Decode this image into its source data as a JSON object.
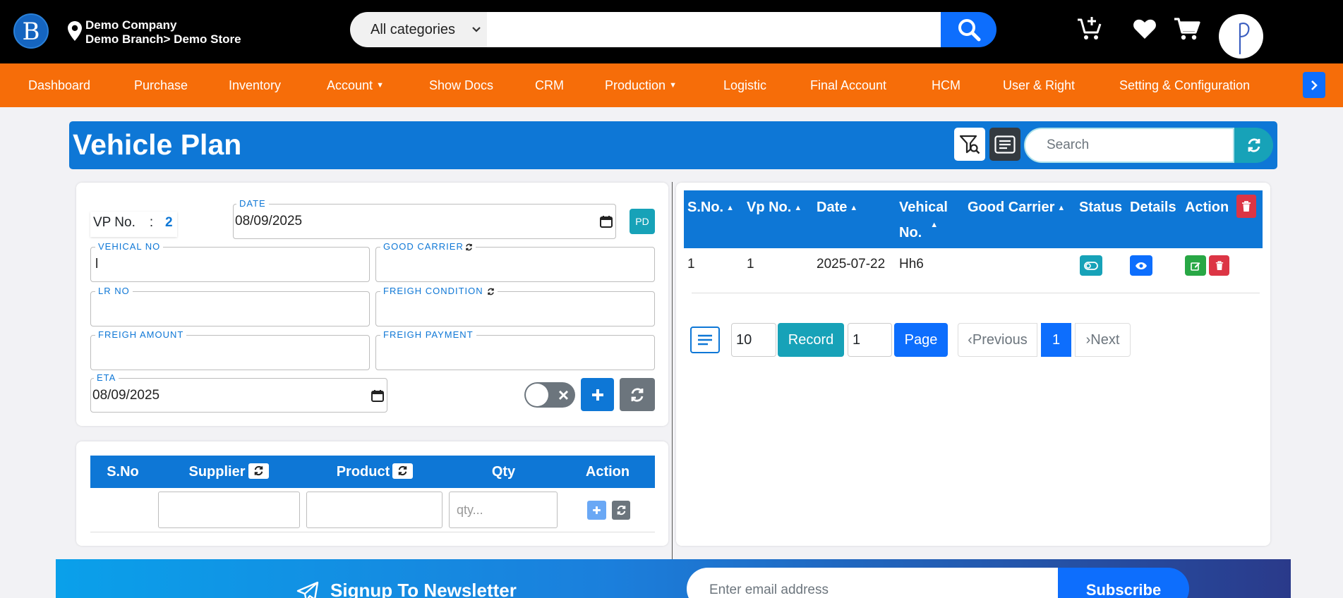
{
  "topbar": {
    "logo_letter": "B",
    "company": "Demo Company",
    "branch": "Demo Branch> Demo Store",
    "category_select": "All categories",
    "search_value": ""
  },
  "nav": [
    "Dashboard",
    "Purchase",
    "Inventory",
    "Account",
    "Show Docs",
    "CRM",
    "Production",
    "Logistic",
    "Final Account",
    "HCM",
    "User & Right",
    "Setting & Configuration"
  ],
  "header": {
    "title": "Vehicle Plan",
    "search_placeholder": "Search"
  },
  "form": {
    "vp_label": "VP No.",
    "vp_sep": ":",
    "vp_value": "2",
    "date_label": "DATE",
    "date_value": "08/09/2025",
    "pd_label": "PD",
    "vehical_no_label": "VEHICAL NO",
    "vehical_no_value": "l",
    "good_carrier_label": "GOOD CARRIER",
    "lr_no_label": "LR NO",
    "freigh_condition_label": "FREIGH CONDITION",
    "freigh_amount_label": "FREIGH AMOUNT",
    "freigh_payment_label": "FREIGH PAYMENT",
    "eta_label": "ETA",
    "eta_value": "08/09/2025"
  },
  "items_table": {
    "headers": [
      "S.No",
      "Supplier",
      "Product",
      "Qty",
      "Action"
    ],
    "qty_placeholder": "qty..."
  },
  "list_table": {
    "headers": {
      "sno": "S.No.",
      "vpno": "Vp No.",
      "date": "Date",
      "vehical_1": "Vehical",
      "vehical_2": "No.",
      "carrier": "Good Carrier",
      "status": "Status",
      "details": "Details",
      "action": "Action"
    },
    "rows": [
      {
        "sno": "1",
        "vpno": "1",
        "date": "2025-07-22",
        "vehical": "Hh6",
        "carrier": ""
      }
    ]
  },
  "pagination": {
    "per_page": "10",
    "record_label": "Record",
    "page_input": "1",
    "page_label": "Page",
    "prev": "‹Previous",
    "current": "1",
    "next": "›Next"
  },
  "newsletter": {
    "title": "Signup To Newsletter",
    "placeholder": "Enter email address",
    "button": "Subscribe"
  },
  "colors": {
    "primary": "#0e77d6",
    "nav": "#f66d09",
    "teal": "#17a2b8",
    "danger": "#dc3545",
    "success": "#28a745"
  }
}
